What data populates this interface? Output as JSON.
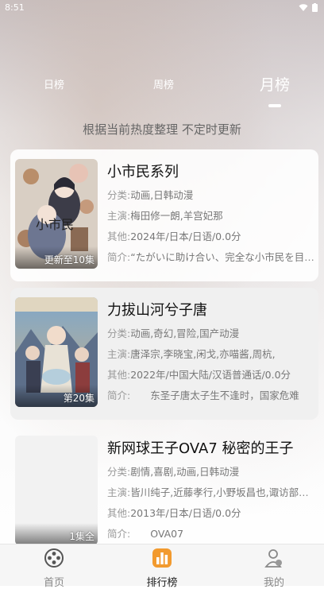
{
  "status_bar": {
    "time": "8:51"
  },
  "tabs": [
    {
      "label": "日榜",
      "active": false
    },
    {
      "label": "周榜",
      "active": false
    },
    {
      "label": "月榜",
      "active": true
    }
  ],
  "subtitle": "根据当前热度整理 不定时更新",
  "labels": {
    "category": "分类:",
    "cast": "主演:",
    "other": "其他:",
    "intro": "简介:"
  },
  "items": [
    {
      "title": "小市民系列",
      "badge": "更新至10集",
      "poster_text": "小市民",
      "category": "动画,日韩动漫",
      "cast": "梅田修一朗,羊宫妃那",
      "other": "2024年/日本/日语/0.0分",
      "intro": "“たがいに助け合い、完全な小市民を目指す”"
    },
    {
      "title": "力拔山河兮子唐",
      "badge": "第20集",
      "category": "动画,奇幻,冒险,国产动漫",
      "cast": "唐泽宗,李晓宝,闲戈,亦喵酱,周杭,",
      "other": "2022年/中国大陆/汉语普通话/0.0分",
      "intro": "　　东圣子唐太子生不逢时，国家危难"
    },
    {
      "title": "新网球王子OVA7 秘密的王子",
      "badge": "1集全",
      "category": "剧情,喜剧,动画,日韩动漫",
      "cast": "皆川纯子,近藤孝行,小野坂昌也,诹访部顺一",
      "other": "2013年/日本/日语/0.0分",
      "intro": "　　OVA07"
    }
  ],
  "bottom_nav": [
    {
      "label": "首页",
      "icon": "film-reel-icon",
      "active": false
    },
    {
      "label": "排行榜",
      "icon": "ranking-chart-icon",
      "active": true
    },
    {
      "label": "我的",
      "icon": "user-icon",
      "active": false
    }
  ],
  "colors": {
    "accent": "#f29a2e",
    "nav_bg": "#f6f6f6"
  }
}
